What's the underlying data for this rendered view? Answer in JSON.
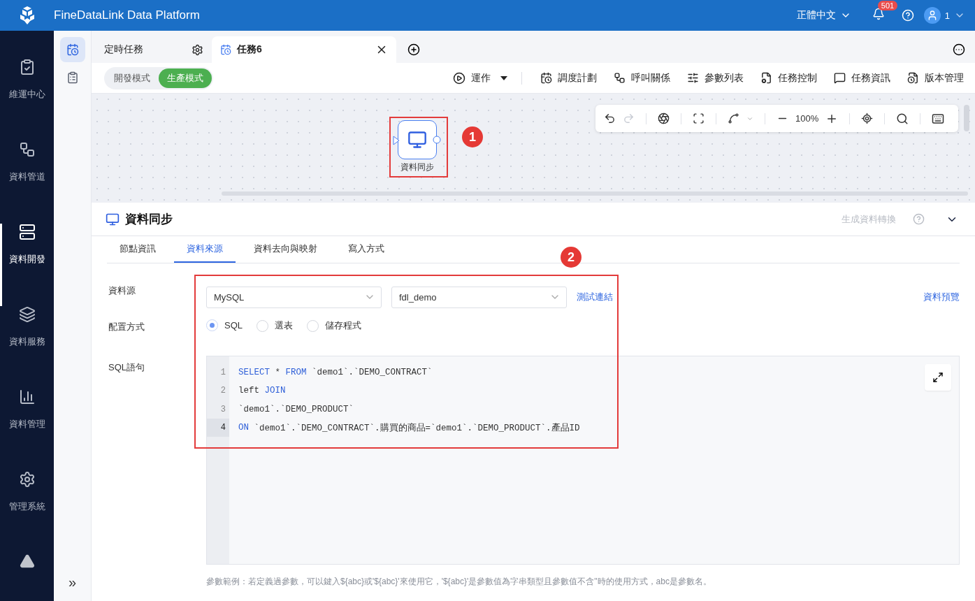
{
  "app": {
    "title": "FineDataLink Data Platform"
  },
  "header": {
    "language": "正體中文",
    "notification_count": "501",
    "user": "1"
  },
  "nav": [
    {
      "label": "維運中心",
      "selected": false
    },
    {
      "label": "資料管道",
      "selected": false
    },
    {
      "label": "資料開發",
      "selected": true
    },
    {
      "label": "資料服務",
      "selected": false
    },
    {
      "label": "資料管理",
      "selected": false
    },
    {
      "label": "管理系統",
      "selected": false
    }
  ],
  "sub_sidebar": {
    "items": [
      {
        "selected": true
      },
      {
        "selected": false
      }
    ],
    "expand": "»"
  },
  "tabs": [
    {
      "label": "定時任務",
      "selected": false,
      "kind": "settings"
    },
    {
      "label": "任務6",
      "selected": true,
      "kind": "closable"
    }
  ],
  "modes": [
    {
      "label": "開發模式",
      "selected": false
    },
    {
      "label": "生產模式",
      "selected": true
    }
  ],
  "run_button": "運作",
  "actions": [
    "調度計劃",
    "呼叫關係",
    "參數列表",
    "任務控制",
    "任務資訊",
    "版本管理"
  ],
  "canvas": {
    "zoom": "100%",
    "redo_disabled": true,
    "node": {
      "label": "資料同步"
    }
  },
  "annotations": [
    {
      "number": "1"
    },
    {
      "number": "2"
    }
  ],
  "panel": {
    "title": "資料同步",
    "generate": {
      "label": "生成資料轉換",
      "disabled": true
    },
    "tabs": [
      {
        "label": "節點資訊",
        "selected": false
      },
      {
        "label": "資料來源",
        "selected": true
      },
      {
        "label": "資料去向與映射",
        "selected": false
      },
      {
        "label": "寫入方式",
        "selected": false
      }
    ],
    "form": {
      "source_label": "資料源",
      "db_type": "MySQL",
      "database": "fdl_demo",
      "test_link": "測試連結",
      "preview_link": "資料預覽",
      "config_label": "配置方式",
      "config_options": [
        {
          "label": "SQL",
          "selected": true
        },
        {
          "label": "選表",
          "selected": false
        },
        {
          "label": "儲存程式",
          "selected": false
        }
      ],
      "sql_label": "SQL語句",
      "code": [
        {
          "number": "1",
          "active": false,
          "tokens": [
            {
              "text": "SELECT",
              "kind": "keyword"
            },
            {
              "text": " * ",
              "kind": "plain"
            },
            {
              "text": "FROM",
              "kind": "keyword"
            },
            {
              "text": " `demo1`.`DEMO_CONTRACT`",
              "kind": "plain"
            }
          ]
        },
        {
          "number": "2",
          "active": false,
          "tokens": [
            {
              "text": "left ",
              "kind": "plain"
            },
            {
              "text": "JOIN",
              "kind": "keyword"
            }
          ]
        },
        {
          "number": "3",
          "active": false,
          "tokens": [
            {
              "text": "`demo1`.`DEMO_PRODUCT`",
              "kind": "plain"
            }
          ]
        },
        {
          "number": "4",
          "active": true,
          "tokens": [
            {
              "text": "ON",
              "kind": "keyword"
            },
            {
              "text": " `demo1`.`DEMO_CONTRACT`.購買的商品=`demo1`.`DEMO_PRODUCT`.產品ID",
              "kind": "plain"
            }
          ]
        }
      ]
    },
    "hint": "參數範例：若定義過參數，可以鍵入${abc}或'${abc}'來使用它，'${abc}'是參數值為字串類型且參數值不含\"時的使用方式，abc是參數名。"
  }
}
